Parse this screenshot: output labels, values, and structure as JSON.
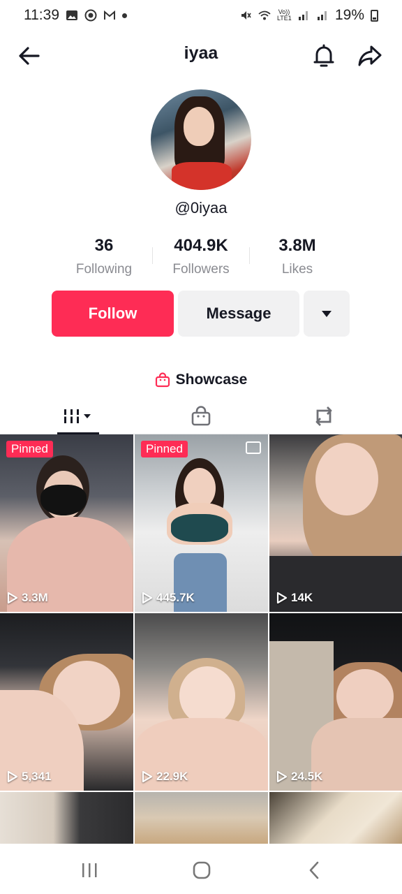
{
  "status_bar": {
    "time": "11:39",
    "battery": "19%",
    "network_label": "Vo)) LTE1",
    "left_icons": [
      "gallery-icon",
      "record-icon",
      "gmail-icon",
      "dot-icon"
    ],
    "right_icons": [
      "mute-icon",
      "wifi-icon",
      "signal-icon",
      "signal-icon",
      "battery-icon"
    ]
  },
  "header": {
    "title": "iyaa",
    "back_icon": "arrow-left-icon",
    "bell_icon": "bell-icon",
    "share_icon": "share-arrow-icon"
  },
  "profile": {
    "username": "@0iyaa"
  },
  "stats": {
    "following": {
      "count": "36",
      "label": "Following"
    },
    "followers": {
      "count": "404.9K",
      "label": "Followers"
    },
    "likes": {
      "count": "3.8M",
      "label": "Likes"
    }
  },
  "actions": {
    "follow_label": "Follow",
    "message_label": "Message",
    "more_icon": "caret-down-icon"
  },
  "colors": {
    "accent": "#fe2c55",
    "secondary_button": "#f1f1f2",
    "text_primary": "#161823",
    "text_secondary": "#8a8b91"
  },
  "showcase": {
    "label": "Showcase",
    "icon": "shopping-bag-icon"
  },
  "tabs": [
    {
      "name": "videos",
      "icon": "grid-bars-icon",
      "active": true
    },
    {
      "name": "shop",
      "icon": "shopping-bag-icon",
      "active": false
    },
    {
      "name": "reposts",
      "icon": "repost-icon",
      "active": false
    }
  ],
  "videos": [
    {
      "views": "3.3M",
      "pinned": true,
      "pinned_label": "Pinned"
    },
    {
      "views": "445.7K",
      "pinned": true,
      "pinned_label": "Pinned"
    },
    {
      "views": "14K",
      "pinned": false
    },
    {
      "views": "5,341",
      "pinned": false
    },
    {
      "views": "22.9K",
      "pinned": false
    },
    {
      "views": "24.5K",
      "pinned": false
    }
  ],
  "nav_bar": {
    "icons": [
      "recents-icon",
      "home-icon",
      "back-icon"
    ]
  }
}
